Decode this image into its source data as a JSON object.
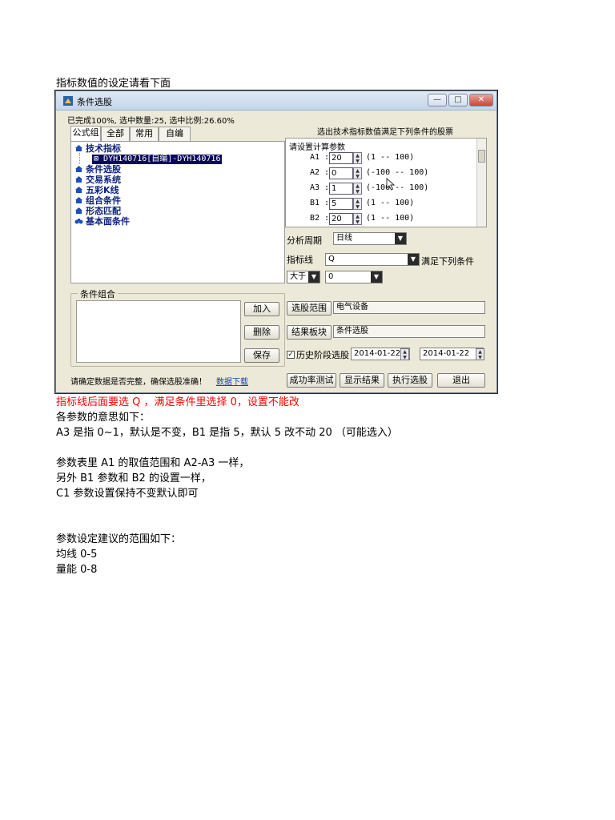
{
  "doc": {
    "heading": "指标数值的设定请看下面",
    "red_note": "指标线后面要选 Q ，满足条件里选择 0，设置不能改",
    "param_note": "各参数的意思如下：",
    "line_a3": "A3 是指 0~1，默认是不变，B1 是指 5，默认 5 改不动 20 （可能选入）",
    "line_a1": "参数表里 A1 的取值范围和 A2-A3 一样，",
    "line_b1": "另外 B1 参数和 B2 的设置一样，",
    "line_c1": "C1 参数设置保持不变默认即可",
    "range_heading": "参数设定建议的范围如下：",
    "range1": "均线 0-5",
    "range2": "量能 0-8"
  },
  "window": {
    "title": "条件选股",
    "status": "已完成100%, 选中数量:25, 选中比例:26.60%",
    "tabs": [
      "公式组",
      "全部",
      "常用",
      "自编"
    ],
    "tree": {
      "root": "技术指标",
      "selected": "DYH140716[自编]-DYH140716",
      "items": [
        "条件选股",
        "交易系统",
        "五彩K线",
        "组合条件",
        "形态匹配",
        "基本面条件"
      ]
    },
    "group_legend": "条件组合",
    "buttons": {
      "add": "加入",
      "delete": "删除",
      "save": "保存"
    },
    "bottom_note": "请确定数据是否完整，确保选股准确！",
    "bottom_link": "数据下载",
    "right_title": "选出技术指标数值满足下列条件的股票",
    "param_head": "请设置计算参数",
    "params": [
      {
        "label": "A1 :",
        "value": "20",
        "range": "(1 -- 100)"
      },
      {
        "label": "A2 :",
        "value": "0",
        "range": "(-100 -- 100)"
      },
      {
        "label": "A3 :",
        "value": "1",
        "range": "(-100 -- 100)"
      },
      {
        "label": "B1 :",
        "value": "5",
        "range": "(1 -- 100)"
      },
      {
        "label": "B2 :",
        "value": "20",
        "range": "(1 -- 100)"
      }
    ],
    "period_label": "分析周期",
    "period_value": "日线",
    "line_label": "指标线",
    "line_value": "Q",
    "line_suffix": "满足下列条件",
    "compare_value": "大于",
    "threshold_value": "0",
    "range_button": "选股范围",
    "range_value": "电气设备",
    "result_button": "结果板块",
    "result_value": "条件选股",
    "history_label": "历史阶段选股",
    "date_from": "2014-01-22",
    "date_to": "2014-01-22",
    "action_buttons": {
      "test": "成功率测试",
      "show": "显示结果",
      "run": "执行选股",
      "exit": "退出"
    }
  },
  "colors": {
    "red_text": "#ff0000",
    "tree_text": "#0b1f7a",
    "selection": "#0a0a5c"
  },
  "icons": {
    "tree": "house-icon",
    "selected": "formula-icon",
    "last": "binoculars-icon"
  }
}
